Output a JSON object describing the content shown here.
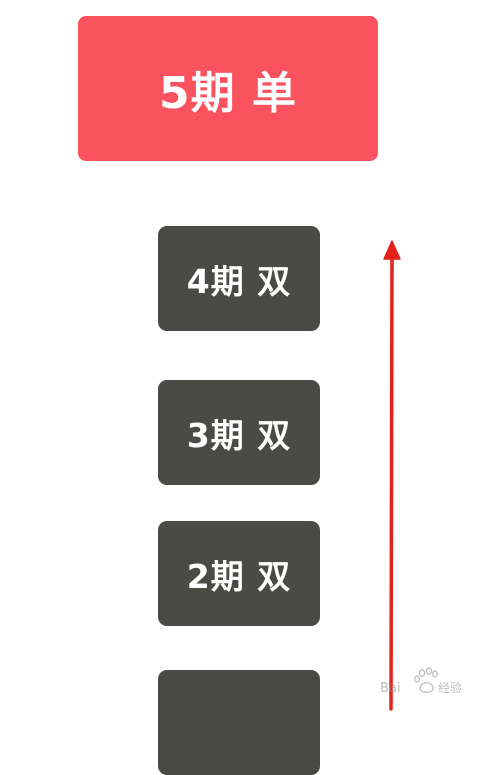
{
  "top_card": {
    "label": "5期 单",
    "color": "#fb5260"
  },
  "steps": [
    {
      "label": "4期 双"
    },
    {
      "label": "3期 双"
    },
    {
      "label": "2期 双"
    },
    {
      "label": ""
    }
  ],
  "step_color": "#4a4a46",
  "arrow": {
    "icon": "up-arrow-icon",
    "color": "#e4211b"
  },
  "watermark": {
    "text": "Bai 经验",
    "icon": "baidu-paw-icon"
  }
}
